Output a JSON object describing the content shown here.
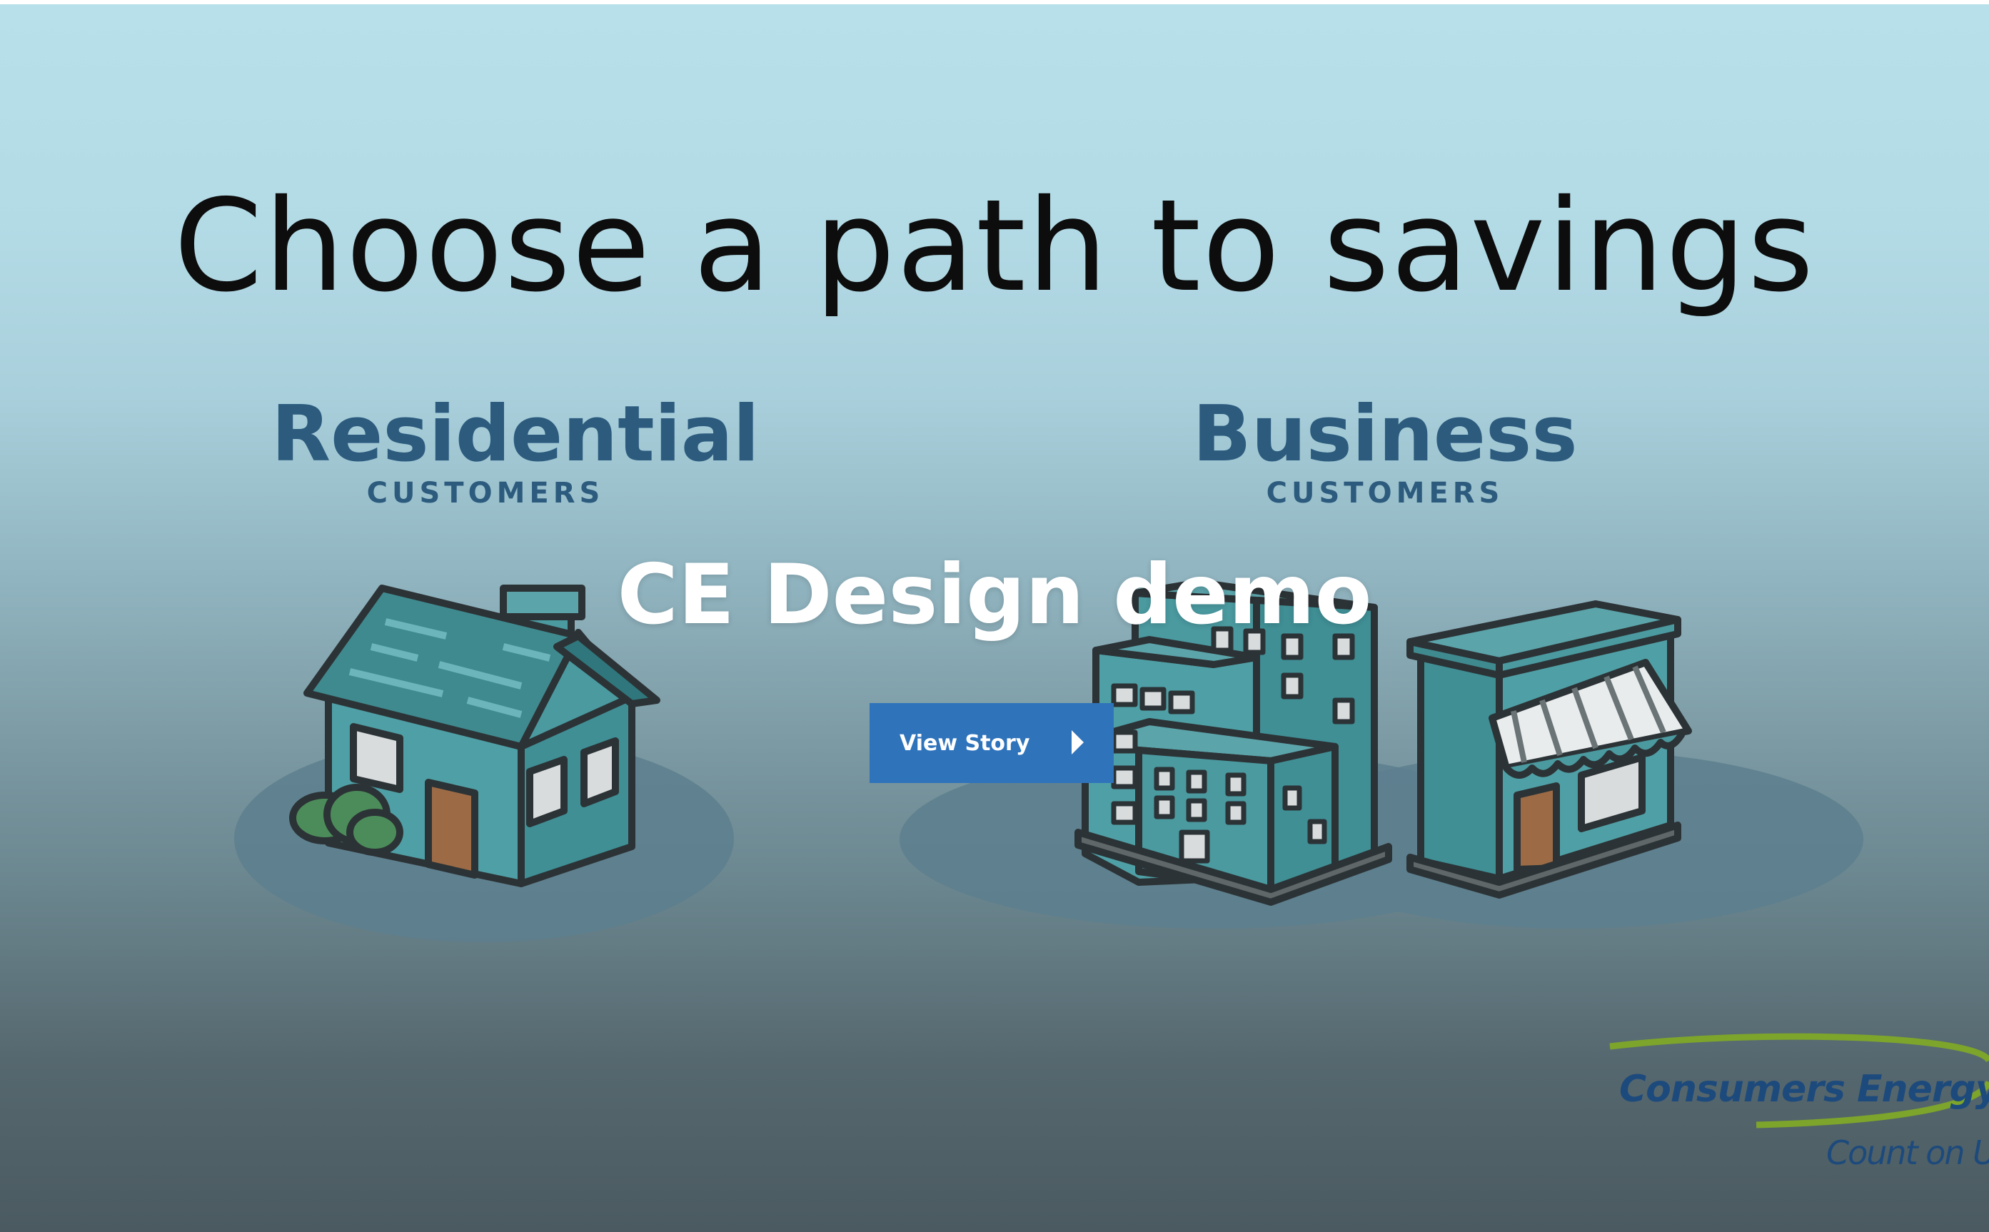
{
  "slide": {
    "headline": "Choose a path to savings",
    "residential": {
      "title": "Residential",
      "subtitle": "CUSTOMERS"
    },
    "business": {
      "title": "Business",
      "subtitle": "CUSTOMERS"
    }
  },
  "overlay": {
    "title": "CE Design demo",
    "view_story_label": "View Story"
  },
  "logo": {
    "name": "Consumers Energy",
    "tagline": "Count on Us"
  },
  "colors": {
    "accent_blue": "#2f73bb",
    "segment_title": "#2c5b7e",
    "building_teal": "#4a9aa0",
    "logo_green": "#7da42b"
  },
  "icons": [
    "house-icon",
    "office-buildings-icon",
    "storefront-icon",
    "play-arrow-icon"
  ]
}
